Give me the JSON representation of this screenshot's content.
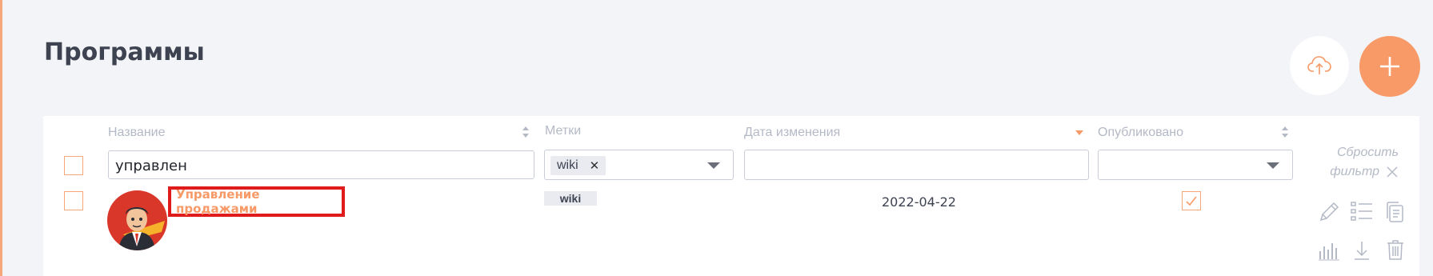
{
  "page": {
    "title": "Программы"
  },
  "fab": {
    "upload_icon": "cloud-upload-icon",
    "add_icon": "plus-icon"
  },
  "table": {
    "columns": {
      "name": "Название",
      "tags": "Метки",
      "modified": "Дата изменения",
      "published": "Опубликовано"
    },
    "filters": {
      "name_value": "управлен",
      "tags_selected": [
        "wiki"
      ],
      "modified_value": "",
      "published_value": ""
    },
    "reset_filter": {
      "line1": "Сбросить",
      "line2": "фильтр"
    },
    "rows": [
      {
        "name": "Управление продажами",
        "tag": "wiki",
        "modified": "2022-04-22",
        "published": true,
        "actions": [
          "pencil-icon",
          "list-icon",
          "copy-icon",
          "bar-chart-icon",
          "download-icon",
          "trash-icon"
        ]
      }
    ]
  },
  "colors": {
    "accent": "#f79a68",
    "annotation_red": "#e01b1b",
    "muted_text": "#b4b9c6",
    "title_text": "#3d4350",
    "background": "#f3f4f8"
  }
}
